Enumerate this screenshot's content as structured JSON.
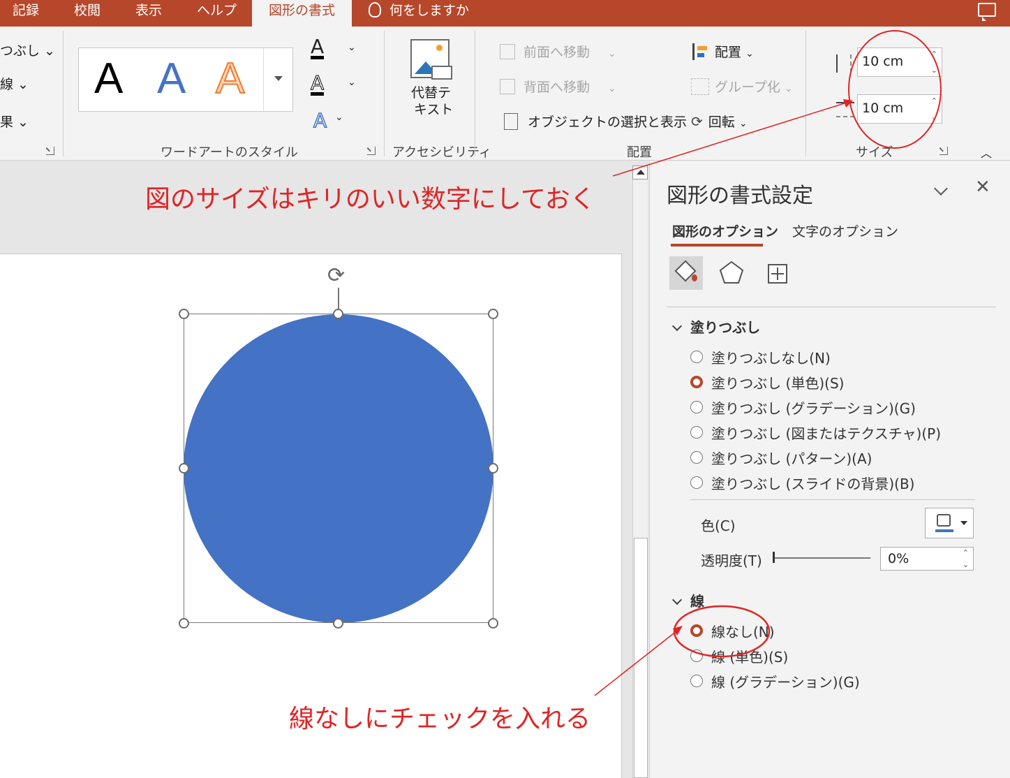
{
  "tabs": {
    "record": "記録",
    "review": "校閲",
    "view": "表示",
    "help": "ヘルプ",
    "shape_format": "図形の書式",
    "tell_me": "何をしますか"
  },
  "ribbon": {
    "shape_styles_partial": [
      "つぶし",
      "線",
      "果"
    ],
    "wordart": {
      "label": "ワードアートのスタイル",
      "letters": [
        "A",
        "A",
        "A"
      ],
      "text_fill": "A",
      "text_outline": "A",
      "text_effects": "A"
    },
    "accessibility": {
      "alt_text_line1": "代替テ",
      "alt_text_line2": "キスト",
      "label": "アクセシビリティ"
    },
    "arrange": {
      "bring_forward": "前面へ移動",
      "send_backward": "背面へ移動",
      "selection_pane": "オブジェクトの選択と表示",
      "align": "配置",
      "group": "グループ化",
      "rotate": "回転",
      "label": "配置"
    },
    "size": {
      "height": "10 cm",
      "width": "10 cm",
      "label": "サイズ"
    }
  },
  "annotations": {
    "size_note": "図のサイズはキリのいい数字にしておく",
    "line_note": "線なしにチェックを入れる",
    "color": "#e02424"
  },
  "pane": {
    "title": "図形の書式設定",
    "tab_shape": "図形のオプション",
    "tab_text": "文字のオプション",
    "fill_section": "塗りつぶし",
    "fill_options": [
      {
        "label": "塗りつぶしなし(N)",
        "selected": false
      },
      {
        "label": "塗りつぶし (単色)(S)",
        "selected": true
      },
      {
        "label": "塗りつぶし (グラデーション)(G)",
        "selected": false
      },
      {
        "label": "塗りつぶし (図またはテクスチャ)(P)",
        "selected": false
      },
      {
        "label": "塗りつぶし (パターン)(A)",
        "selected": false
      },
      {
        "label": "塗りつぶし (スライドの背景)(B)",
        "selected": false
      }
    ],
    "color_label": "色(C)",
    "transparency_label": "透明度(T)",
    "transparency_value": "0%",
    "line_section": "線",
    "line_options": [
      {
        "label": "線なし(N)",
        "selected": true
      },
      {
        "label": "線 (単色)(S)",
        "selected": false
      },
      {
        "label": "線 (グラデーション)(G)",
        "selected": false
      }
    ]
  },
  "colors": {
    "accent": "#b7472a",
    "shape_fill": "#4472c4"
  }
}
